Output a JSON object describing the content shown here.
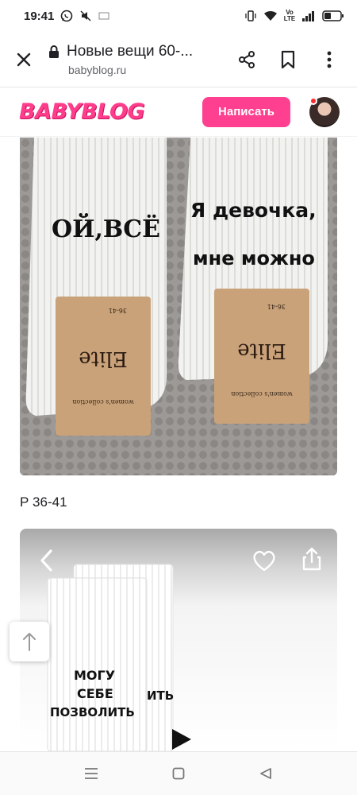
{
  "status_bar": {
    "time": "19:41",
    "icons": [
      "whatsapp-icon",
      "mute-icon",
      "cast-icon",
      "vibrate-icon",
      "wifi-icon",
      "volte-icon",
      "signal-icon",
      "battery-icon"
    ],
    "volte_label": "Vo LTE"
  },
  "browser": {
    "title": "Новые вещи 60-...",
    "url": "babyblog.ru"
  },
  "site": {
    "logo": "BABYBLOG",
    "write_button": "Написать",
    "brand_color": "#ff3f8f"
  },
  "photo1": {
    "left_sock_text": "ОЙ,ВСЁ",
    "right_sock_text_line1": "Я девочка,",
    "right_sock_text_line2": "мне можно",
    "tag_brand": "Elite",
    "tag_collection": "women's collection",
    "tag_size": "36-41"
  },
  "caption": "Р 36-41",
  "photo2": {
    "sock_text_line1": "МОГУ",
    "sock_text_line2": "СЕБЕ",
    "sock_text_line3": "ПОЗВОЛИТЬ",
    "back_sock_text": "ИТЬ"
  },
  "nav": {
    "buttons": [
      "menu",
      "home",
      "back"
    ]
  }
}
